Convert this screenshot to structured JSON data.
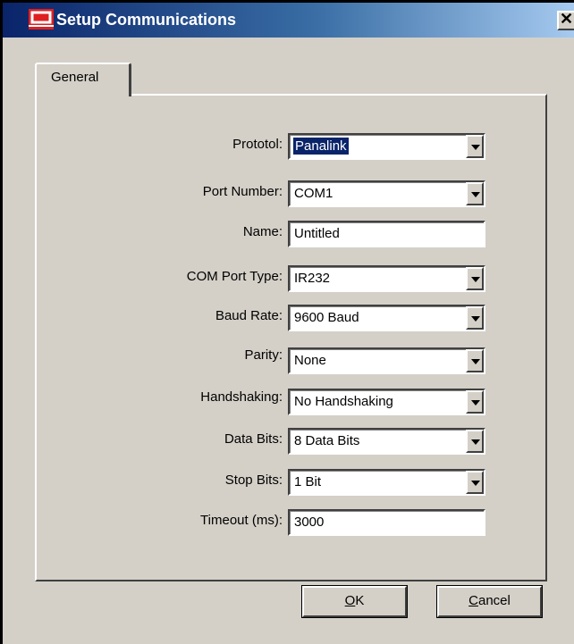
{
  "window": {
    "title": "Setup Communications",
    "close_glyph": "✕"
  },
  "tabs": [
    {
      "label": "General"
    }
  ],
  "fields": [
    {
      "label": "Prototol:",
      "value": "Panalink",
      "type": "select",
      "selected": true
    },
    {
      "label": "Port Number:",
      "value": "COM1",
      "type": "select"
    },
    {
      "label": "Name:",
      "value": "Untitled",
      "type": "text"
    },
    {
      "label": "COM Port Type:",
      "value": "IR232",
      "type": "select"
    },
    {
      "label": "Baud Rate:",
      "value": "9600 Baud",
      "type": "select"
    },
    {
      "label": "Parity:",
      "value": "None",
      "type": "select"
    },
    {
      "label": "Handshaking:",
      "value": "No Handshaking",
      "type": "select"
    },
    {
      "label": "Data Bits:",
      "value": "8 Data Bits",
      "type": "select"
    },
    {
      "label": "Stop Bits:",
      "value": "1 Bit",
      "type": "select"
    },
    {
      "label": "Timeout (ms):",
      "value": "3000",
      "type": "text"
    }
  ],
  "buttons": {
    "ok": {
      "accel": "O",
      "rest": "K"
    },
    "cancel": {
      "accel": "C",
      "rest": "ancel"
    }
  },
  "colors": {
    "title_start": "#0a246a",
    "title_end": "#a6caf0",
    "face": "#d4d0c8",
    "icon": "#e02020"
  }
}
